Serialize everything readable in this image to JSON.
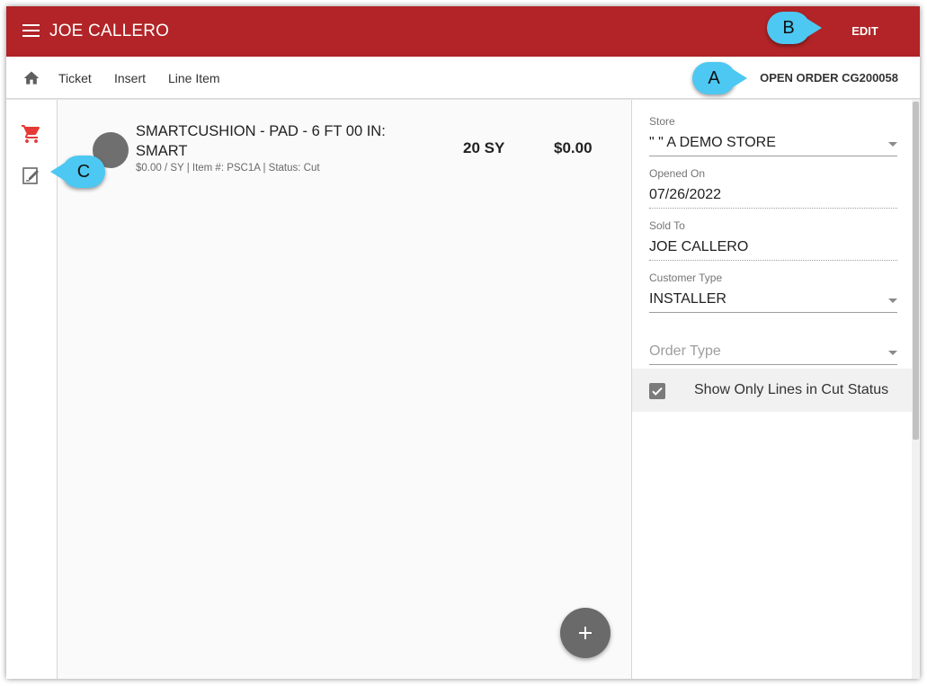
{
  "app": {
    "title": "JOE CALLERO",
    "edit_label": "EDIT"
  },
  "nav": {
    "links": [
      "Ticket",
      "Insert",
      "Line Item"
    ],
    "order_label": "OPEN ORDER CG200058"
  },
  "line_item": {
    "name": "SMARTCUSHION - PAD - 6 FT 00 IN: SMART",
    "meta": "$0.00 / SY  |  Item #: PSC1A  |  Status: Cut",
    "quantity": "20 SY",
    "amount": "$0.00"
  },
  "panel": {
    "store": {
      "label": "Store",
      "value": "\" \" A DEMO STORE"
    },
    "opened_on": {
      "label": "Opened On",
      "value": "07/26/2022"
    },
    "sold_to": {
      "label": "Sold To",
      "value": "JOE CALLERO"
    },
    "customer_type": {
      "label": "Customer Type",
      "value": "INSTALLER"
    },
    "order_type": {
      "placeholder": "Order Type"
    },
    "show_cut_only": {
      "label": "Show Only Lines in Cut Status",
      "checked": true
    }
  },
  "callouts": {
    "a": "A",
    "b": "B",
    "c": "C"
  },
  "colors": {
    "topbar": "#b22427",
    "cart_icon": "#e53935",
    "callout": "#4cc8f2"
  },
  "icons": [
    "menu-icon",
    "home-icon",
    "cart-icon",
    "edit-note-icon",
    "add-icon",
    "check-icon",
    "dropdown-caret-icon"
  ]
}
